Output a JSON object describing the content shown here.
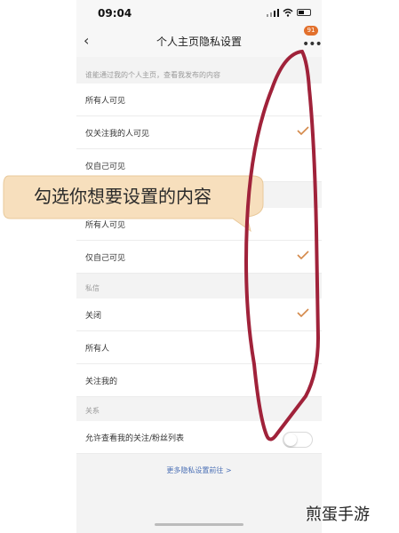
{
  "status_bar": {
    "time": "09:04"
  },
  "nav": {
    "title": "个人主页隐私设置",
    "badge": "91"
  },
  "sections": [
    {
      "header": "谁能通过我的个人主页，查看我发布的内容",
      "items": [
        {
          "label": "所有人可见",
          "checked": false
        },
        {
          "label": "仅关注我的人可见",
          "checked": true
        },
        {
          "label": "仅自己可见",
          "checked": false
        }
      ]
    },
    {
      "header": "",
      "items": [
        {
          "label": "所有人可见",
          "checked": false
        },
        {
          "label": "仅自己可见",
          "checked": true
        }
      ]
    },
    {
      "header": "私信",
      "items": [
        {
          "label": "关闭",
          "checked": true
        },
        {
          "label": "所有人",
          "checked": false
        },
        {
          "label": "关注我的",
          "checked": false
        }
      ]
    },
    {
      "header": "关系",
      "items": [
        {
          "label": "允许查看我的关注/粉丝列表",
          "toggle": false
        }
      ]
    }
  ],
  "more_link": "更多隐私设置前往 >",
  "annotation": {
    "bubble_text": "勾选你想要设置的内容"
  },
  "watermark": "煎蛋手游",
  "colors": {
    "accent": "#e2702c",
    "check": "#d4894a",
    "link": "#4a6fb5",
    "annotation_stroke": "#a0223a",
    "bubble_fill": "#f7dfbd"
  },
  "icons": [
    "back-arrow-icon",
    "more-dots-icon",
    "checkmark-icon",
    "signal-icon",
    "wifi-icon",
    "battery-icon"
  ]
}
